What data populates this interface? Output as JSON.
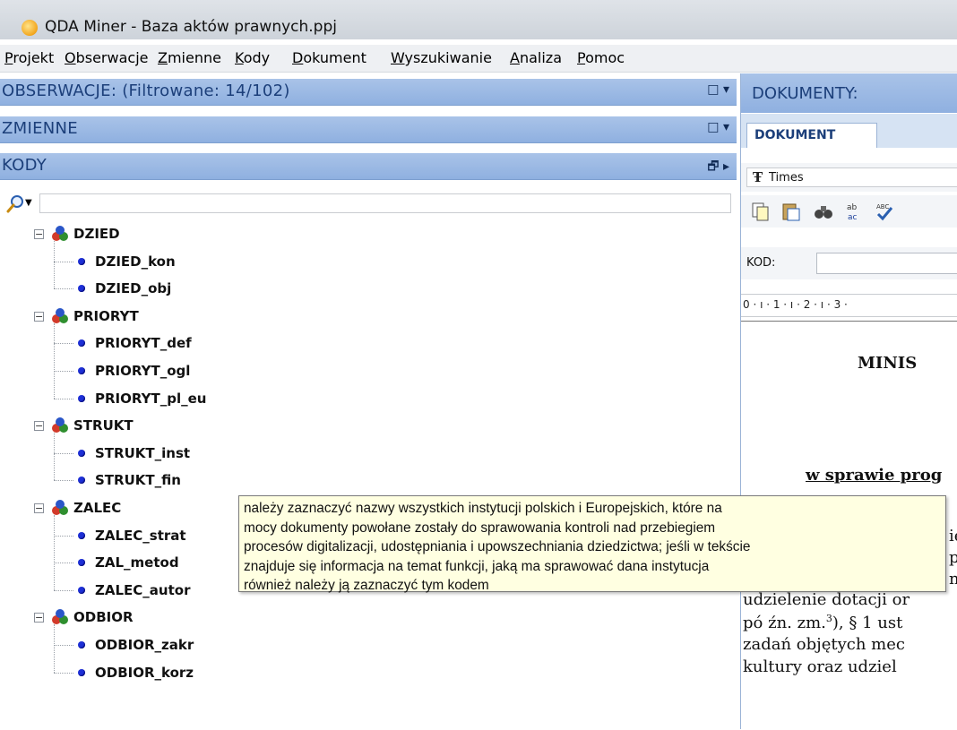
{
  "window": {
    "title": "QDA Miner - Baza aktów prawnych.ppj"
  },
  "menu": [
    "Projekt",
    "Obserwacje",
    "Zmienne",
    "Kody",
    "Dokument",
    "Wyszukiwanie",
    "Analiza",
    "Pomoc"
  ],
  "left": {
    "observations": {
      "title": "OBSERWACJE: (Filtrowane: 14/102)",
      "ctrl": "□ ▾"
    },
    "variables": {
      "title": "ZMIENNE",
      "ctrl": "□ ▾"
    },
    "codes": {
      "title": "KODY",
      "ctrl": "🗗 ▸"
    },
    "search": {
      "value": "",
      "placeholder": ""
    }
  },
  "tree": [
    {
      "label": "DZIED",
      "children": [
        "DZIED_kon",
        "DZIED_obj"
      ]
    },
    {
      "label": "PRIORYT",
      "children": [
        "PRIORYT_def",
        "PRIORYT_ogl",
        "PRIORYT_pl_eu"
      ]
    },
    {
      "label": "STRUKT",
      "children": [
        "STRUKT_inst",
        "STRUKT_fin"
      ]
    },
    {
      "label": "ZALEC",
      "children": [
        "ZALEC_strat",
        "ZAL_metod",
        "ZALEC_autor"
      ]
    },
    {
      "label": "ODBIOR",
      "children": [
        "ODBIOR_zakr",
        "ODBIOR_korz"
      ]
    }
  ],
  "tooltip": {
    "lines": [
      "należy zaznaczyć nazwy wszystkich instytucji polskich i Europejskich, które na",
      "mocy dokumenty powołane zostały do sprawowania kontroli nad przebiegiem",
      "procesów digitalizacji, udostępniania i upowszechniania dziedzictwa; jeśli w tekście",
      "znajduje się informacja na temat funkcji, jaką ma sprawować dana instytucja",
      "również należy ją zaznaczyć tym kodem"
    ]
  },
  "right": {
    "header": "DOKUMENTY:",
    "tab": "DOKUMENT",
    "font": "Times",
    "kod_label": "KOD:",
    "ruler": "0 · ı · 1 · ı · 2 · ı · 3 ·",
    "doc_lines": [
      "MINIS",
      "w sprawie prog",
      "ie",
      "po",
      "n",
      "udzielenie dotacji or",
      "pó źn. zm.",
      "3",
      "), § 1 ust",
      "zadań objętych mec",
      "kultury oraz udziel"
    ]
  },
  "colors": {
    "section_bar": "#8fb0e0",
    "section_text": "#1c3f7a",
    "tooltip_bg": "#ffffe1",
    "code_dot": "#1d2fd6"
  }
}
